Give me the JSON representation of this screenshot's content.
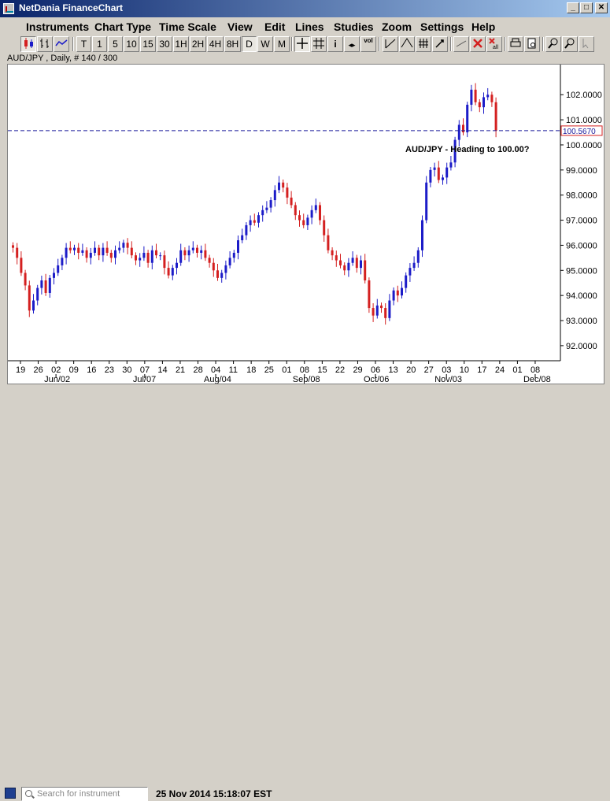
{
  "window": {
    "title": "NetDania FinanceChart"
  },
  "menu": [
    "Instruments",
    "Chart Type",
    "Time Scale",
    "View",
    "Edit",
    "Lines",
    "Studies",
    "Zoom",
    "Settings",
    "Help"
  ],
  "toolbar": {
    "periods": [
      "T",
      "1",
      "5",
      "10",
      "15",
      "30",
      "1H",
      "2H",
      "4H",
      "8H",
      "D",
      "W",
      "M"
    ],
    "active_period": "D",
    "vol_label": "vol"
  },
  "chart_header": "AUD/JPY , Daily, # 140 / 300",
  "status": {
    "search_placeholder": "Search for instrument",
    "datetime": "25 Nov 2014 15:18:07 EST"
  },
  "colors": {
    "up": "#1c1cc8",
    "down": "#d42020",
    "current_line": "#1a1a9a",
    "title_bar": "#0a246a"
  },
  "chart_data": {
    "type": "candlestick",
    "instrument": "AUD/JPY",
    "timeframe": "Daily",
    "annotation": "AUD/JPY - Heading to 100.00?",
    "current_price": "100.5670",
    "current_value": 100.567,
    "ylim": [
      91.4,
      103.2
    ],
    "y_ticks": [
      "92.0000",
      "93.0000",
      "94.0000",
      "95.0000",
      "96.0000",
      "97.0000",
      "98.0000",
      "99.0000",
      "100.0000",
      "101.0000",
      "102.0000"
    ],
    "x_ticks": [
      "19",
      "26",
      "02",
      "09",
      "16",
      "23",
      "30",
      "07",
      "14",
      "21",
      "28",
      "04",
      "11",
      "18",
      "25",
      "01",
      "08",
      "15",
      "22",
      "29",
      "06",
      "13",
      "20",
      "27",
      "03",
      "10",
      "17",
      "24",
      "01",
      "08"
    ],
    "x_months": [
      "Jun/02",
      "Jul/07",
      "Aug/04",
      "Sep/08",
      "Oct/06",
      "Nov/03",
      "Dec/08"
    ],
    "closes": [
      95.9,
      95.5,
      94.9,
      94.4,
      93.4,
      93.8,
      94.3,
      94.6,
      94.1,
      94.7,
      94.9,
      95.2,
      95.5,
      95.9,
      95.8,
      95.9,
      95.7,
      95.8,
      95.5,
      95.7,
      95.9,
      95.6,
      95.9,
      95.7,
      95.5,
      95.8,
      95.9,
      96.1,
      95.9,
      95.6,
      95.4,
      95.5,
      95.7,
      95.3,
      95.8,
      95.6,
      95.6,
      95.1,
      94.8,
      95.1,
      95.3,
      95.8,
      95.6,
      95.8,
      95.9,
      95.7,
      95.8,
      95.5,
      95.3,
      95.0,
      94.7,
      94.9,
      95.2,
      95.5,
      95.7,
      96.2,
      96.4,
      96.8,
      97.0,
      96.9,
      97.2,
      97.4,
      97.5,
      97.8,
      98.2,
      98.5,
      98.3,
      97.9,
      97.6,
      97.2,
      97.0,
      96.8,
      97.1,
      97.4,
      97.6,
      97.0,
      96.4,
      95.8,
      95.6,
      95.4,
      95.2,
      95.0,
      95.3,
      95.5,
      95.1,
      95.4,
      94.6,
      93.5,
      93.2,
      93.6,
      93.5,
      93.1,
      93.8,
      94.2,
      94.0,
      94.3,
      94.8,
      95.1,
      95.3,
      95.8,
      97.0,
      98.5,
      99.0,
      99.1,
      98.6,
      98.7,
      99.1,
      99.3,
      100.2,
      100.8,
      100.5,
      101.6,
      102.2,
      101.7,
      101.5,
      101.9,
      102.0,
      101.7,
      100.567
    ]
  }
}
